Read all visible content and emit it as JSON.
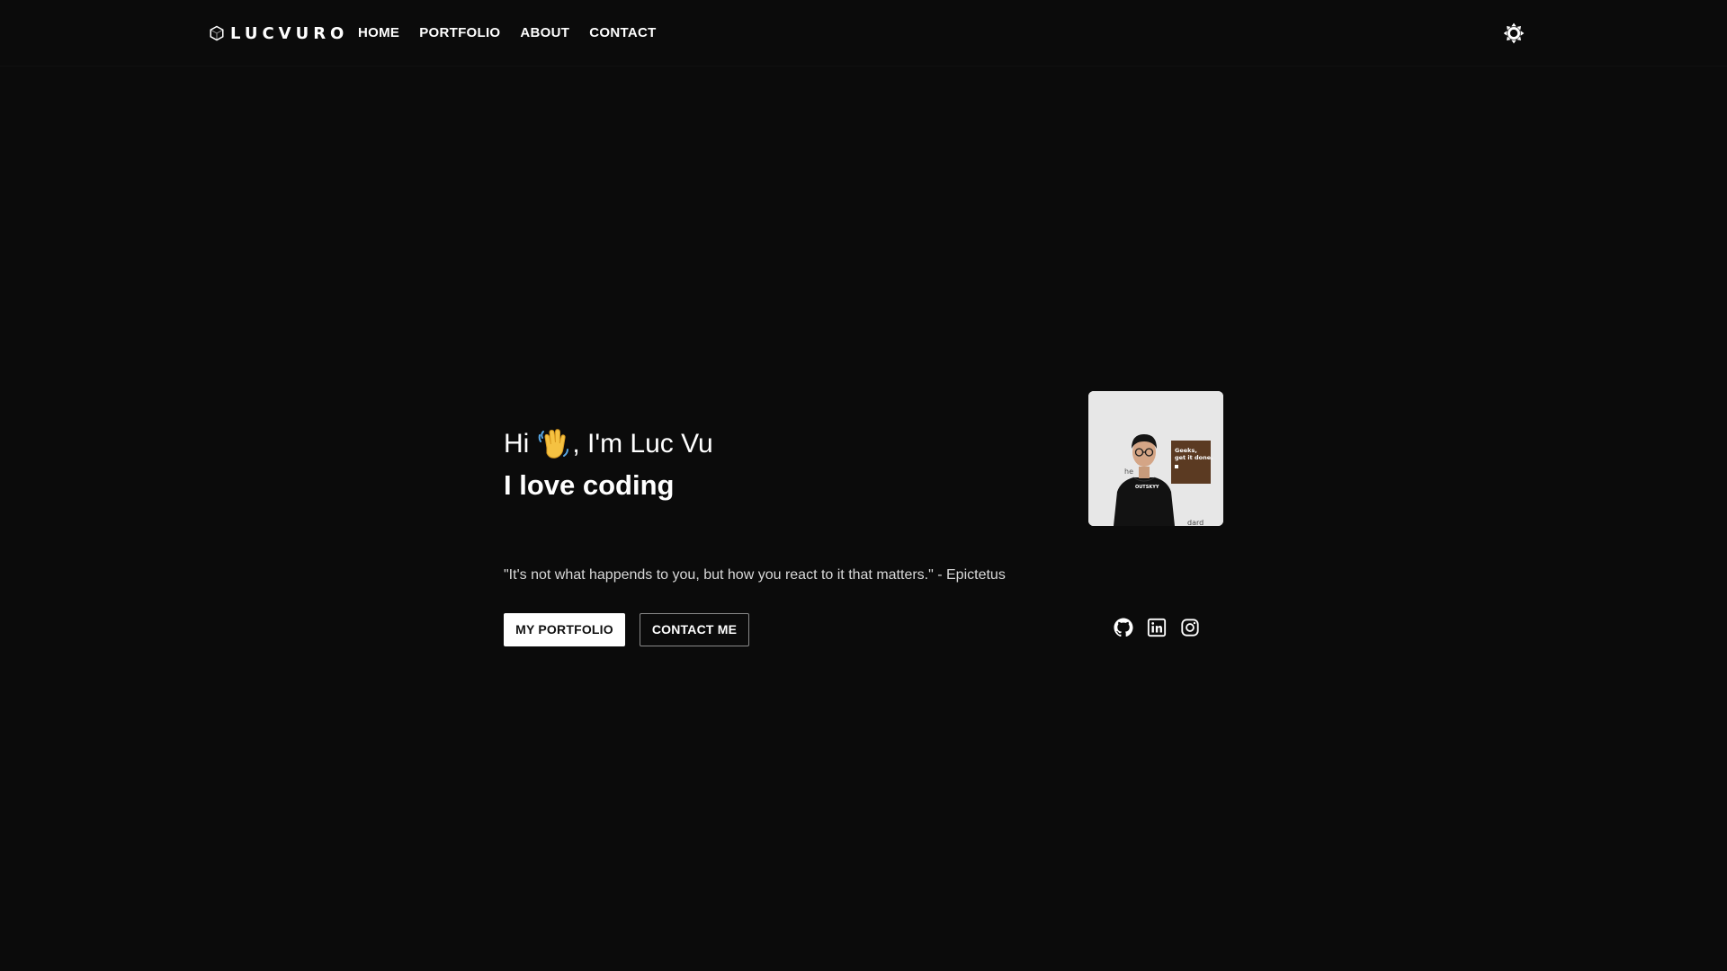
{
  "navbar": {
    "brand": "LUCVURO",
    "brand_icon": "hexagon-icon",
    "links": [
      "HOME",
      "PORTFOLIO",
      "ABOUT",
      "CONTACT"
    ],
    "theme_toggle_icon": "sun-icon"
  },
  "hero": {
    "greeting_prefix": "Hi",
    "greeting_emoji": "waving-hand-icon",
    "greeting_suffix": ", I'm Luc Vu",
    "tagline": "I love coding",
    "quote": "\"It's not what happends to you, but how you react to it that matters.\" - Epictetus",
    "primary_button": "MY PORTFOLIO",
    "secondary_button": "CONTACT ME"
  },
  "avatar": {
    "poster_text": "Geeks, get it done."
  },
  "socials": [
    "github-icon",
    "linkedin-icon",
    "instagram-icon"
  ],
  "colors": {
    "background": "#0b0b0b",
    "text": "#ffffff",
    "muted_text": "#d8d8d8"
  }
}
